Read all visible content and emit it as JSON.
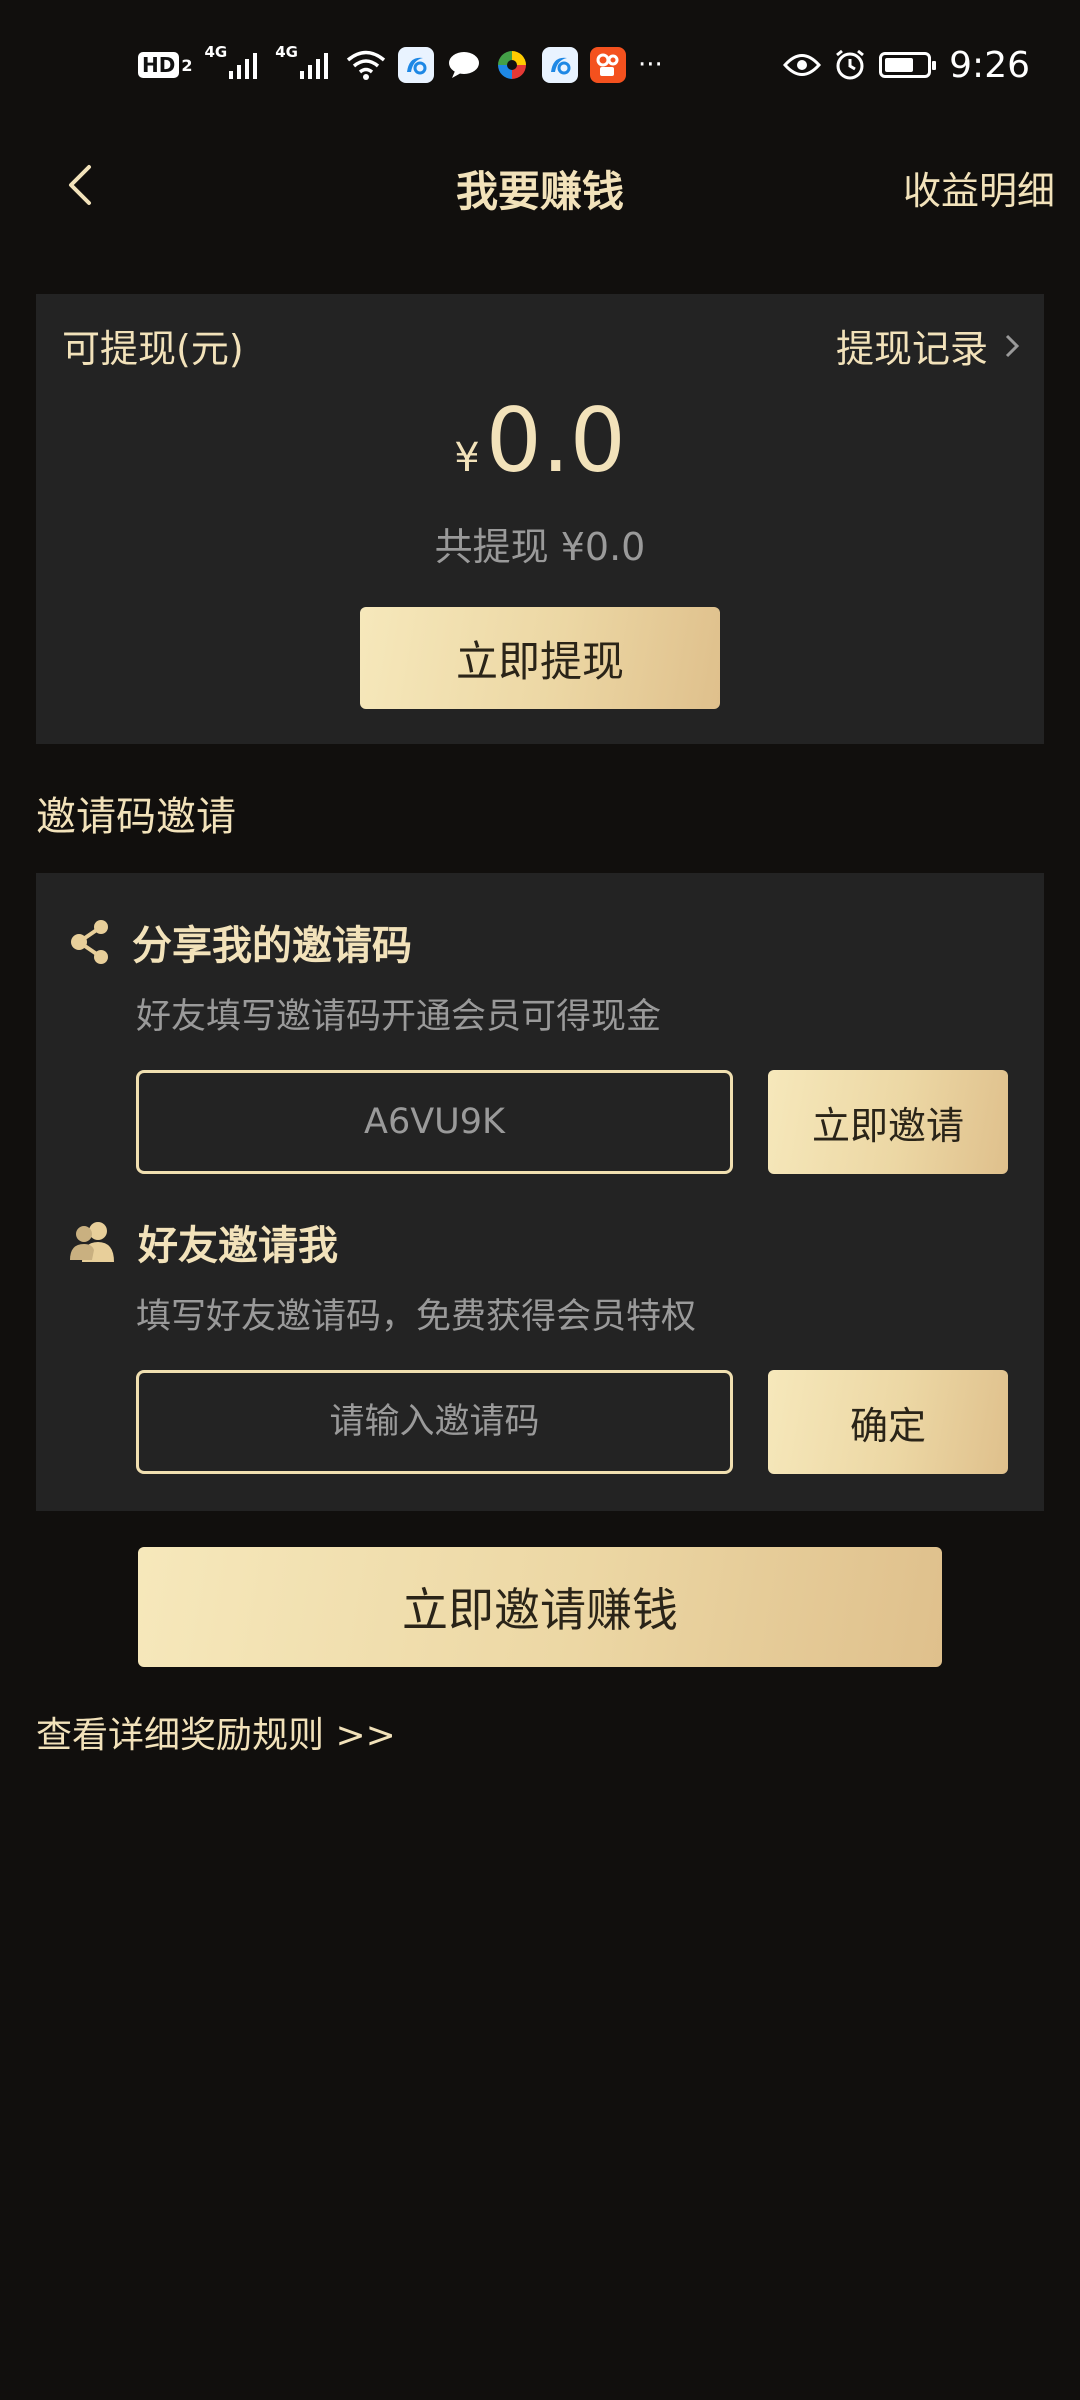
{
  "status_bar": {
    "hd": "HD",
    "hd_sub": "2",
    "net1": "4G",
    "net2": "4G",
    "more": "···",
    "time": "9:26",
    "battery_level": 0.7
  },
  "nav": {
    "title": "我要赚钱",
    "right_link": "收益明细"
  },
  "balance": {
    "label": "可提现(元)",
    "record_link": "提现记录",
    "currency": "¥",
    "amount": "0.0",
    "total": "共提现 ¥0.0",
    "withdraw_button": "立即提现"
  },
  "invite_section": {
    "title": "邀请码邀请",
    "share": {
      "heading": "分享我的邀请码",
      "desc": "好友填写邀请码开通会员可得现金",
      "code": "A6VU9K",
      "button": "立即邀请"
    },
    "friend": {
      "heading": "好友邀请我",
      "desc": "填写好友邀请码，免费获得会员特权",
      "placeholder": "请输入邀请码",
      "button": "确定"
    }
  },
  "cta_button": "立即邀请赚钱",
  "rules_link": "查看详细奖励规则 >>",
  "colors": {
    "background": "#110f0d",
    "card": "#232323",
    "gold_text": "#f2e2ba",
    "muted_text": "#9a9a9a"
  }
}
